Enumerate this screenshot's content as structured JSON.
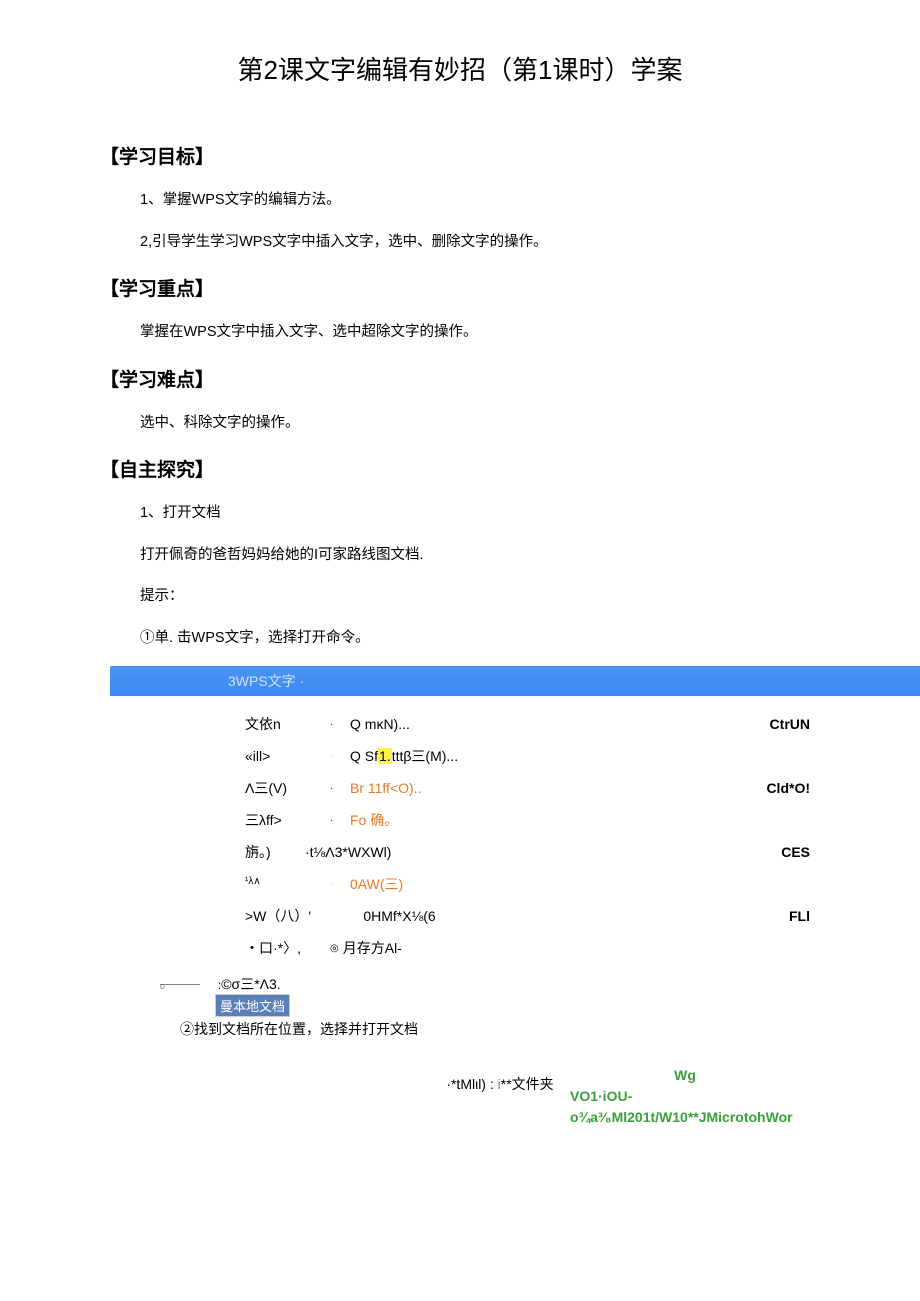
{
  "title": "第2课文字编辑有妙招（第1课时）学案",
  "sec1": "【学习目标】",
  "goal1": "1、掌握WPS文字的编辑方法。",
  "goal2": "2,引导学生学习WPS文字中插入文字，选中、删除文字的操作。",
  "sec2": "【学习重点】",
  "focus": "掌握在WPS文字中插入文字、选中超除文字的操作。",
  "sec3": "【学习难点】",
  "hard": "选中、科除文字的操作。",
  "sec4": "【自主探究】",
  "step1": "1、打开文档",
  "step1_desc": "打开佩奇的爸哲妈妈给她的I可家路线图文档.",
  "tip_label": "提示：",
  "tip1": "①单. 击WPS文字，选择打开命令。",
  "menubar_text": "3WPS文字 ·",
  "menu": [
    {
      "left": "文依n",
      "dot": "·",
      "mid_pre": "Q ",
      "mid": "mκN)...",
      "right": "CtrUN"
    },
    {
      "left": "«ill>",
      "dot": "·",
      "mid_pre": "Q Sf",
      "mid_hl": "1.",
      "mid_post": "tttβ三(M)...",
      "right": ""
    },
    {
      "left": "Λ三(V)",
      "dot": "·",
      "mid_orange": "Br 11ff<O)..",
      "right": "Cld*O!"
    },
    {
      "left": "三λff>",
      "dot": "·",
      "mid_orange": "Fo 确。",
      "right": ""
    },
    {
      "left": "旃。)",
      "mid_nolead": "·t⅛Λ3*WXWl)",
      "right": "CES"
    },
    {
      "left_sup": "¹λ∧",
      "dot": "·",
      "mid_orange": "0AW(三)",
      "right": ""
    },
    {
      "left": ">W（八）'",
      "mid_plain": "      0HMf*X⅛(6",
      "right": "FLl"
    },
    {
      "left": "・口·*〉,",
      "mid_plain_o": "◎月存方Al-",
      "right": ""
    }
  ],
  "copyright_line": "©σ三*Λ3.",
  "local_doc": "曼本地文档",
  "tip2": "②找到文档所在位置，选择并打开文档",
  "green_text": "Wg VO1·iOU- o¾a³⁄₈Ml201t/W10**JMicrotohWor",
  "green_wg": "Wg",
  "green_l2": "VO1·iOU-",
  "green_l3": "o¾a³⁄₈Ml201t/W10**JMicrotohWor",
  "last_line_pre": "·*tMlιl) : ",
  "last_line_blue": "i",
  "last_line_post": "**文件夹"
}
